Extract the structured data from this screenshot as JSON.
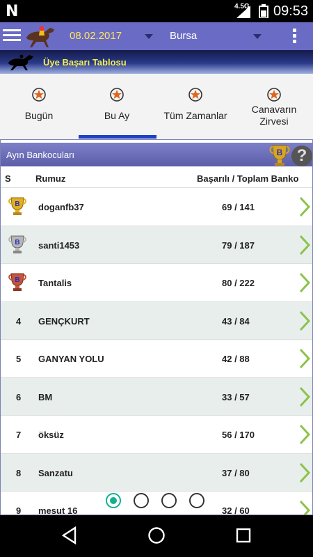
{
  "status_bar": {
    "time": "09:53",
    "network": "4.5G",
    "notification_letter": "N"
  },
  "app_bar": {
    "date": "08.02.2017",
    "city": "Bursa"
  },
  "banner": {
    "title": "Üye Başarı Tablosu"
  },
  "tabs": [
    {
      "label": "Bugün"
    },
    {
      "label": "Bu Ay",
      "selected": true
    },
    {
      "label": "Tüm Zamanlar"
    },
    {
      "label": "Canavarın Zirvesi"
    }
  ],
  "card": {
    "title": "Ayın Bankocuları",
    "badge_letter": "B",
    "help_glyph": "?",
    "columns": {
      "rank": "S",
      "nick": "Rumuz",
      "score": "Başarılı / Toplam Banko"
    }
  },
  "rows": [
    {
      "rank": "",
      "trophy": "gold",
      "nick": "doganfb37",
      "score": "69 / 141"
    },
    {
      "rank": "",
      "trophy": "silver",
      "nick": "santi1453",
      "score": "79 / 187"
    },
    {
      "rank": "",
      "trophy": "bronze",
      "nick": "Tantalis",
      "score": "80 / 222"
    },
    {
      "rank": "4",
      "nick": "GENÇKURT",
      "score": "43 / 84"
    },
    {
      "rank": "5",
      "nick": "GANYAN YOLU",
      "score": "42 / 88"
    },
    {
      "rank": "6",
      "nick": "BM",
      "score": "33 / 57"
    },
    {
      "rank": "7",
      "nick": "öksüz",
      "score": "56 / 170"
    },
    {
      "rank": "8",
      "nick": "Sanzatu",
      "score": "37 / 80"
    },
    {
      "rank": "9",
      "nick": "mesut 16",
      "score": "32 / 60"
    }
  ],
  "pager": {
    "pages": 4,
    "active_index": 0
  },
  "colors": {
    "app_bar": "#6a6bc4",
    "date_text": "#ffe45c",
    "banner_title": "#f6f04e",
    "tab_indicator": "#1e40c8",
    "row_alt": "#e8eeec",
    "chevron": "#8bc34a",
    "pager_active": "#13b08e"
  }
}
